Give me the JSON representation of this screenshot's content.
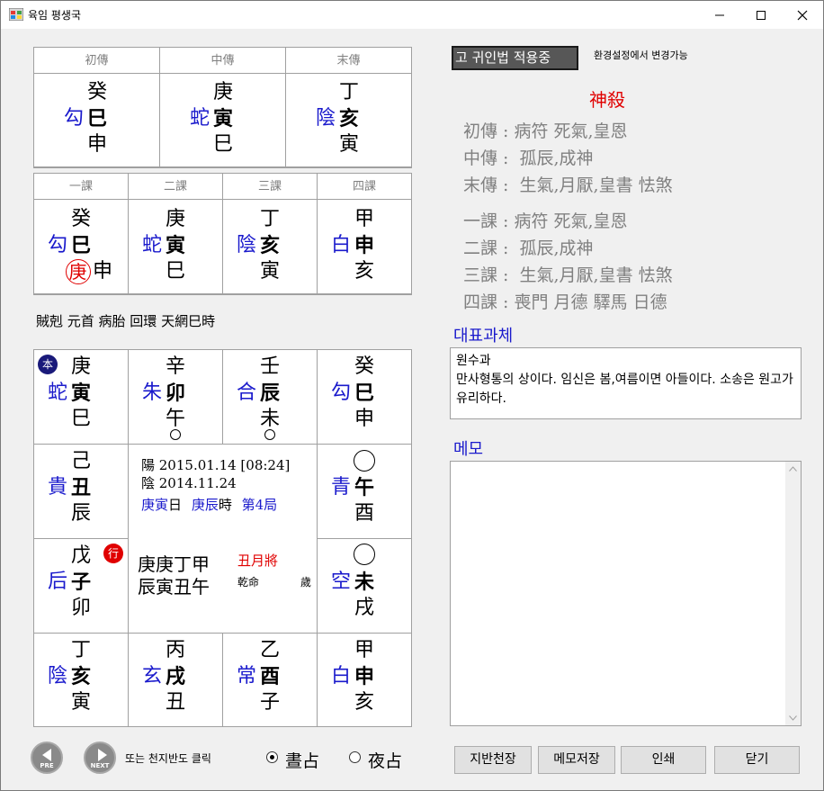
{
  "window": {
    "title": "육임 평생국"
  },
  "samjeon": {
    "headers": [
      "初傳",
      "中傳",
      "末傳"
    ],
    "columns": [
      {
        "stem": "癸",
        "general": "勾",
        "branch1": "巳",
        "branch2": "申"
      },
      {
        "stem": "庚",
        "general": "蛇",
        "branch1": "寅",
        "branch2": "巳"
      },
      {
        "stem": "丁",
        "general": "陰",
        "branch1": "亥",
        "branch2": "寅"
      }
    ]
  },
  "sagwa": {
    "headers": [
      "一課",
      "二課",
      "三課",
      "四課"
    ],
    "columns": [
      {
        "stem": "癸",
        "general": "勾",
        "branch1": "巳",
        "branch2": "申",
        "circled": "庚"
      },
      {
        "stem": "庚",
        "general": "蛇",
        "branch1": "寅",
        "branch2": "巳"
      },
      {
        "stem": "丁",
        "general": "陰",
        "branch1": "亥",
        "branch2": "寅"
      },
      {
        "stem": "甲",
        "general": "白",
        "branch1": "申",
        "branch2": "亥"
      }
    ]
  },
  "pattern_line": "賊剋 元首 病胎 回環 天網巳時",
  "board": {
    "row1": [
      {
        "stem": "庚",
        "general": "蛇",
        "branch1": "寅",
        "branch2": "巳",
        "badge": "本"
      },
      {
        "stem": "辛",
        "general": "朱",
        "branch1": "卯",
        "branch2": "午"
      },
      {
        "stem": "壬",
        "general": "合",
        "branch1": "辰",
        "branch2": "未"
      },
      {
        "stem": "癸",
        "general": "勾",
        "branch1": "巳",
        "branch2": "申"
      }
    ],
    "left": [
      {
        "stem": "己",
        "general": "貴",
        "branch1": "丑",
        "branch2": "辰"
      },
      {
        "stem": "戊",
        "general": "后",
        "branch1": "子",
        "branch2": "卯",
        "badge": "行"
      }
    ],
    "right": [
      {
        "general": "青",
        "branch1": "午",
        "branch2": "酉"
      },
      {
        "general": "空",
        "branch1": "未",
        "branch2": "戌"
      }
    ],
    "row4": [
      {
        "stem": "丁",
        "general": "陰",
        "branch1": "亥",
        "branch2": "寅"
      },
      {
        "stem": "丙",
        "general": "玄",
        "branch1": "戌",
        "branch2": "丑"
      },
      {
        "stem": "乙",
        "general": "常",
        "branch1": "酉",
        "branch2": "子"
      },
      {
        "stem": "甲",
        "general": "白",
        "branch1": "申",
        "branch2": "亥"
      }
    ],
    "center": {
      "solar": "陽 2015.01.14 [08:24]",
      "lunar": "陰 2014.11.24",
      "day": "庚寅",
      "day_suffix": "日",
      "hour": "庚辰",
      "hour_suffix": "時",
      "guk": "第4局",
      "pillars_top": "庚庚丁甲",
      "pillars_bottom": "辰寅丑午",
      "month_general": "丑月將",
      "gender": "乾命",
      "age": "歲"
    }
  },
  "nav": {
    "prev_label": "PRE",
    "next_label": "NEXT",
    "hint": "또는 천지반도 클릭",
    "day_label": "晝占",
    "night_label": "夜占"
  },
  "toolbar": {
    "status_button": "고 귀인법 적용중",
    "status_note": "환경설정에서 변경가능"
  },
  "sinsal": {
    "title": "神殺",
    "chuan": [
      "初傳 : 病符 死氣,皇恩",
      "中傳 :  孤辰,成神",
      "末傳 :  生氣,月厭,皇書 怯煞"
    ],
    "ke": [
      "一課 : 病符 死氣,皇恩",
      "二課 :  孤辰,成神",
      "三課 :  生氣,月厭,皇書 怯煞",
      "四課 : 喪門 月德 驛馬 日德"
    ]
  },
  "representative": {
    "label": "대표과체",
    "title": "원수과",
    "text": "만사형통의 상이다. 임신은 봄,여름이면 아들이다. 소송은 원고가 유리하다."
  },
  "memo": {
    "label": "메모",
    "value": ""
  },
  "buttons": {
    "jibancheon": "지반천장",
    "save_memo": "메모저장",
    "print": "인쇄",
    "close": "닫기"
  },
  "colors": {
    "general": "#1a1acc",
    "red": "#e00000",
    "muted": "#808080"
  }
}
